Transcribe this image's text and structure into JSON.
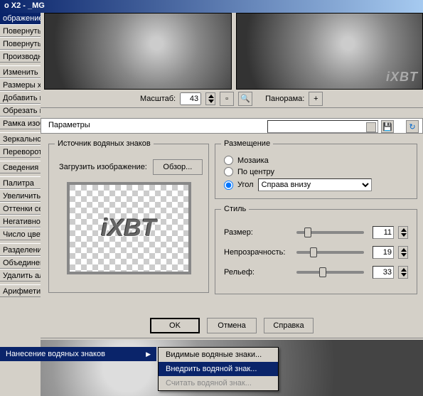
{
  "title": "o X2 - _MG",
  "leftmenu": {
    "hdr": "ображение",
    "items": [
      "Повернуть",
      "Повернуть",
      "Производн",
      "",
      "Изменить р",
      "Размеры хо",
      "Добавить п",
      "Обрезать п",
      "Рамка изоб",
      "",
      "Зеркальное",
      "Переворот",
      "",
      "Сведения о",
      "",
      "Палитра",
      "Увеличить",
      "Оттенки се",
      "Негативное",
      "Число цвет",
      "",
      "Разделение",
      "Объединен",
      "Удалить ал",
      "",
      "Арифметич"
    ]
  },
  "preview_watermark": "iXBT",
  "zoom": {
    "label": "Масштаб:",
    "value": "43",
    "panorama": "Панорама:"
  },
  "params_hdr": "Параметры",
  "source": {
    "legend": "Источник водяных знаков",
    "load": "Загрузить изображение:",
    "browse": "Обзор...",
    "wmtext": "iXBT"
  },
  "place": {
    "legend": "Размещение",
    "mosaic": "Мозаика",
    "center": "По центру",
    "corner": "Угол",
    "corner_opt": "Справа внизу"
  },
  "style": {
    "legend": "Стиль",
    "size": "Размер:",
    "size_v": "11",
    "opacity": "Непрозрачность:",
    "opacity_v": "19",
    "relief": "Рельеф:",
    "relief_v": "33"
  },
  "buttons": {
    "ok": "OK",
    "cancel": "Отмена",
    "help": "Справка"
  },
  "bottom": {
    "main": "Нанесение водяных знаков",
    "sub": [
      "Видимые водяные знаки...",
      "Внедрить водяной знак...",
      "Считать водяной знак..."
    ]
  }
}
